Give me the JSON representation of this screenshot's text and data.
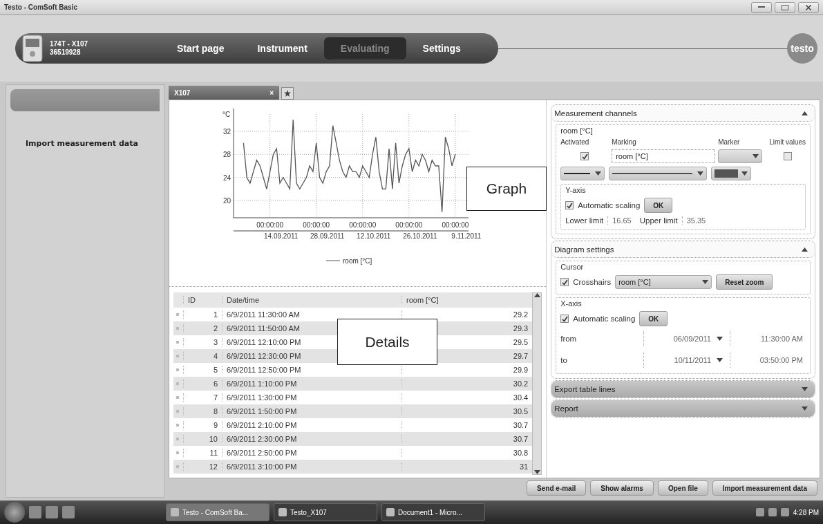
{
  "window": {
    "title": "Testo - ComSoft Basic"
  },
  "device": {
    "name": "174T - X107",
    "serial": "36519928"
  },
  "nav_tabs": [
    {
      "label": "Start page",
      "selected": false
    },
    {
      "label": "Instrument",
      "selected": false
    },
    {
      "label": "Evaluating",
      "selected": true
    },
    {
      "label": "Settings",
      "selected": false
    }
  ],
  "logo": "testo",
  "sidebar": {
    "items": [
      "Import measurement data"
    ]
  },
  "document_tab": {
    "label": "X107",
    "close": "×"
  },
  "graph": {
    "chart_data": {
      "type": "line",
      "ylabel": "°C",
      "grid": true,
      "categories": [
        null,
        null,
        null,
        null,
        null,
        null,
        null,
        null,
        "00:00:00",
        null,
        null,
        null,
        null,
        null,
        null,
        null,
        null,
        null,
        null,
        null,
        null,
        null,
        "00:00:00",
        null,
        null,
        null,
        null,
        null,
        null,
        null,
        null,
        null,
        null,
        null,
        null,
        null,
        "00:00:00",
        null,
        null,
        null,
        null,
        null,
        null,
        null,
        null,
        null,
        null,
        null,
        null,
        null,
        "00:00:00",
        null,
        null,
        null,
        null,
        null,
        null,
        null,
        null,
        null,
        null,
        null,
        null,
        null,
        "00:00:00"
      ],
      "ylim": [
        17,
        35
      ],
      "yticks": [
        20,
        24,
        28,
        32
      ],
      "series": [
        {
          "name": "room [°C]",
          "color": "#555555",
          "values": [
            30,
            24,
            23,
            25,
            27,
            26,
            24,
            22,
            25,
            28,
            29,
            23,
            24,
            23,
            22,
            34,
            23,
            22,
            23,
            24,
            26,
            25,
            30,
            24,
            23,
            25,
            26,
            33,
            30,
            27,
            25,
            24,
            26,
            25,
            25,
            24,
            26,
            25,
            24,
            28,
            31,
            25,
            22,
            22,
            29,
            22,
            30,
            23,
            26,
            28,
            29,
            25,
            27,
            26,
            28,
            27,
            25,
            27,
            26,
            26,
            18,
            31,
            29,
            26,
            28
          ]
        }
      ]
    },
    "x_dates": [
      "14.09.2011",
      "28.09.2011",
      "12.10.2011",
      "26.10.2011",
      "9.11.2011"
    ]
  },
  "callouts": [
    "Graph",
    "Details"
  ],
  "table": {
    "columns": [
      "ID",
      "Date/time",
      "room [°C]"
    ],
    "rows": [
      [
        "1",
        "6/9/2011 11:30:00 AM",
        "29.2"
      ],
      [
        "2",
        "6/9/2011 11:50:00 AM",
        "29.3"
      ],
      [
        "3",
        "6/9/2011 12:10:00 PM",
        "29.5"
      ],
      [
        "4",
        "6/9/2011 12:30:00 PM",
        "29.7"
      ],
      [
        "5",
        "6/9/2011 12:50:00 PM",
        "29.9"
      ],
      [
        "6",
        "6/9/2011 1:10:00 PM",
        "30.2"
      ],
      [
        "7",
        "6/9/2011 1:30:00 PM",
        "30.4"
      ],
      [
        "8",
        "6/9/2011 1:50:00 PM",
        "30.5"
      ],
      [
        "9",
        "6/9/2011 2:10:00 PM",
        "30.7"
      ],
      [
        "10",
        "6/9/2011 2:30:00 PM",
        "30.7"
      ],
      [
        "11",
        "6/9/2011 2:50:00 PM",
        "30.8"
      ],
      [
        "12",
        "6/9/2011 3:10:00 PM",
        "31"
      ]
    ]
  },
  "panels": [
    {
      "kind": "channels",
      "title": "Measurement channels",
      "expanded": true,
      "channel": {
        "group": "room [°C]",
        "columns": [
          "Activated",
          "Marking",
          "Marker",
          "Limit values"
        ],
        "activated": true,
        "marking": "room [°C]",
        "limit_values": false
      },
      "y_axis": {
        "title": "Y-axis",
        "auto_label": "Automatic scaling",
        "auto": true,
        "ok": "OK",
        "lower_label": "Lower limit",
        "lower": "16.65",
        "upper_label": "Upper limit",
        "upper": "35.35"
      }
    },
    {
      "kind": "diagram",
      "title": "Diagram settings",
      "expanded": true,
      "cursor": {
        "title": "Cursor",
        "crosshairs_label": "Crosshairs",
        "crosshairs": true,
        "channel": "room [°C]",
        "reset": "Reset zoom"
      },
      "x_axis": {
        "title": "X-axis",
        "auto_label": "Automatic scaling",
        "auto": true,
        "ok": "OK",
        "from_label": "from",
        "from_date": "06/09/2011",
        "from_time": "11:30:00 AM",
        "to_label": "to",
        "to_date": "10/11/2011",
        "to_time": "03:50:00 PM"
      }
    },
    {
      "kind": "plain",
      "title": "Export table lines",
      "expanded": false
    },
    {
      "kind": "plain",
      "title": "Report",
      "expanded": false
    }
  ],
  "actions": [
    "Send e-mail",
    "Show alarms",
    "Open file",
    "Import measurement data"
  ],
  "taskbar": {
    "tasks": [
      {
        "label": "Testo - ComSoft Ba...",
        "selected": true
      },
      {
        "label": "Testo_X107",
        "selected": false
      },
      {
        "label": "Document1 - Micro...",
        "selected": false
      }
    ],
    "clock": "4:28 PM"
  }
}
